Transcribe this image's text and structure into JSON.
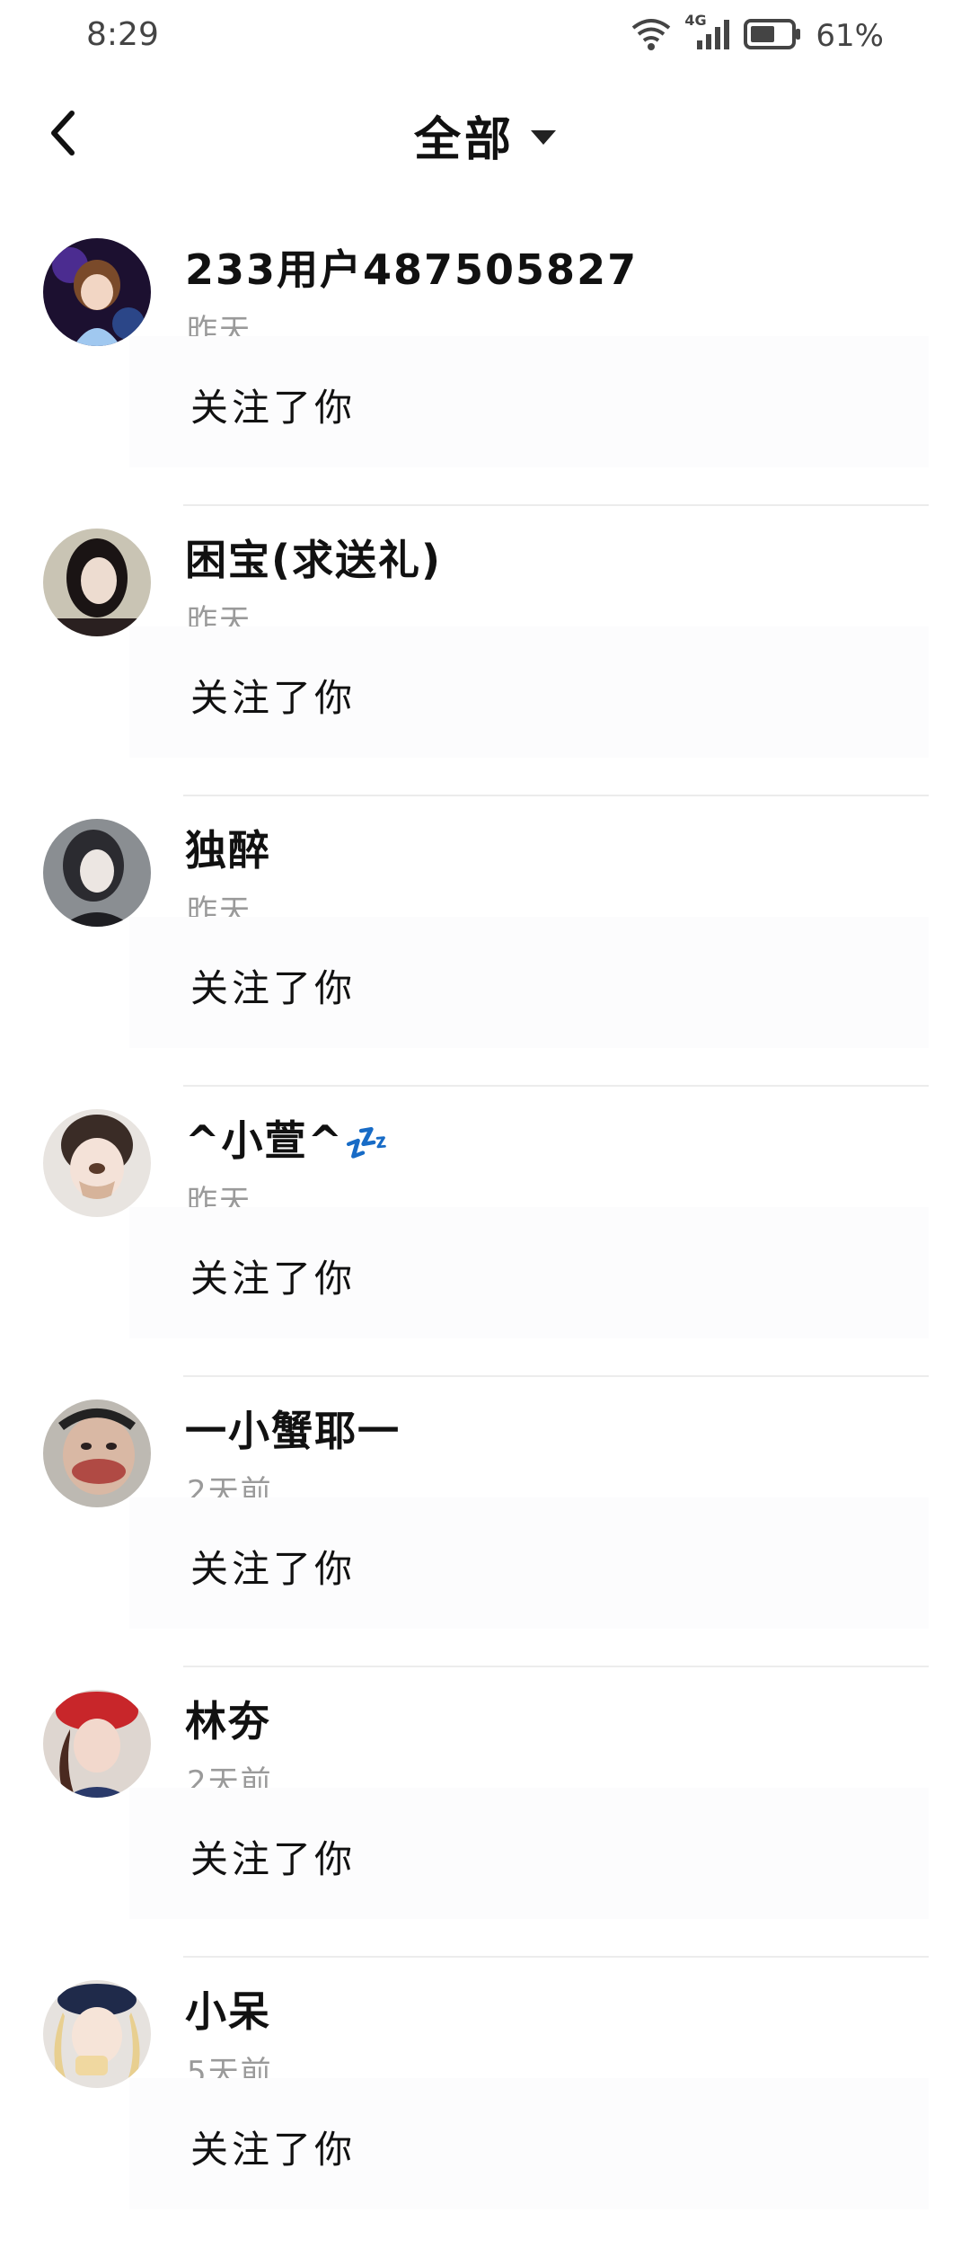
{
  "status": {
    "time": "8:29",
    "network": "4G",
    "battery_pct": "61%",
    "battery_level": 0.61
  },
  "header": {
    "title": "全部"
  },
  "colors": {
    "text": "#111111",
    "muted": "#9a9a9a",
    "divider": "#ececec",
    "zzz": "#2d7fe0"
  },
  "notifications": [
    {
      "name": "233用户487505827",
      "time": "昨天",
      "message": "关注了你",
      "avatar_icon": "avatar-anime-girl-icon"
    },
    {
      "name": "困宝(求送礼)",
      "time": "昨天",
      "message": "关注了你",
      "avatar_icon": "avatar-woman-icon"
    },
    {
      "name": "独醉",
      "time": "昨天",
      "message": "关注了你",
      "avatar_icon": "avatar-anime-woman-icon"
    },
    {
      "name": "^小萱^",
      "name_emoji": "💤",
      "time": "昨天",
      "message": "关注了你",
      "avatar_icon": "avatar-girl-dog-filter-icon"
    },
    {
      "name": "一小蟹耶一",
      "time": "2天前",
      "message": "关注了你",
      "avatar_icon": "avatar-funny-face-icon"
    },
    {
      "name": "林夯",
      "time": "2天前",
      "message": "关注了你",
      "avatar_icon": "avatar-red-beret-girl-icon"
    },
    {
      "name": "小呆",
      "time": "5天前",
      "message": "关注了你",
      "avatar_icon": "avatar-cap-girl-icon"
    }
  ]
}
